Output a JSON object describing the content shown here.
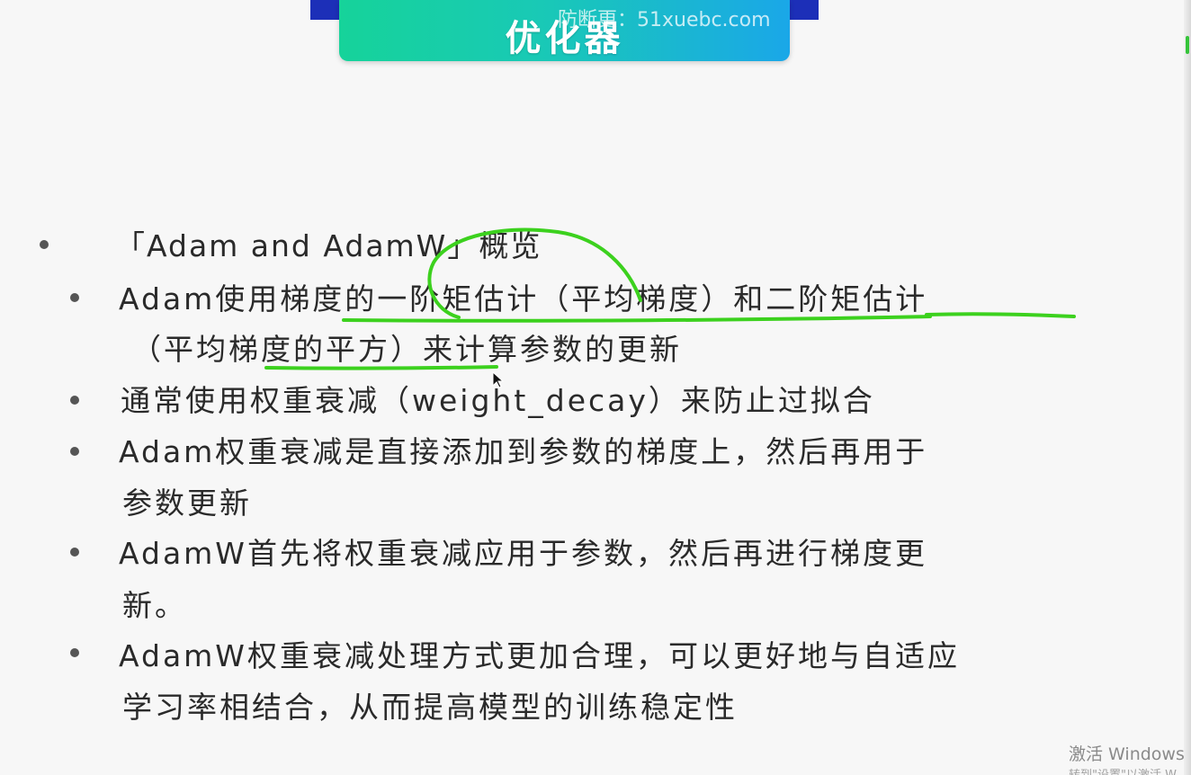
{
  "slide": {
    "title": "优化器",
    "watermark": "防断更：51xuebc.com",
    "bullets": [
      {
        "level": 1,
        "lines": [
          "「Adam and AdamW」概览"
        ]
      },
      {
        "level": 2,
        "lines": [
          "Adam使用梯度的一阶矩估计（平均梯度）和二阶矩估计",
          "（平均梯度的平方）来计算参数的更新"
        ]
      },
      {
        "level": 2,
        "lines": [
          "通常使用权重衰减（weight_decay）来防止过拟合"
        ]
      },
      {
        "level": 2,
        "lines": [
          "Adam权重衰减是直接添加到参数的梯度上，然后再用于",
          "参数更新"
        ]
      },
      {
        "level": 2,
        "lines": [
          "AdamW首先将权重衰减应用于参数，然后再进行梯度更",
          "新。"
        ]
      },
      {
        "level": 2,
        "lines": [
          "AdamW权重衰减处理方式更加合理，可以更好地与自适应",
          "学习率相结合，从而提高模型的训练稳定性"
        ]
      }
    ]
  },
  "os": {
    "activate_title": "激活 Windows",
    "activate_sub": "转到\"设置\"以激活 W"
  },
  "colors": {
    "banner_start": "#16d39a",
    "banner_end": "#1aa7e8",
    "ink": "#3cd11e",
    "bullet": "#555555"
  },
  "icons": [
    "mouse-cursor-icon"
  ]
}
